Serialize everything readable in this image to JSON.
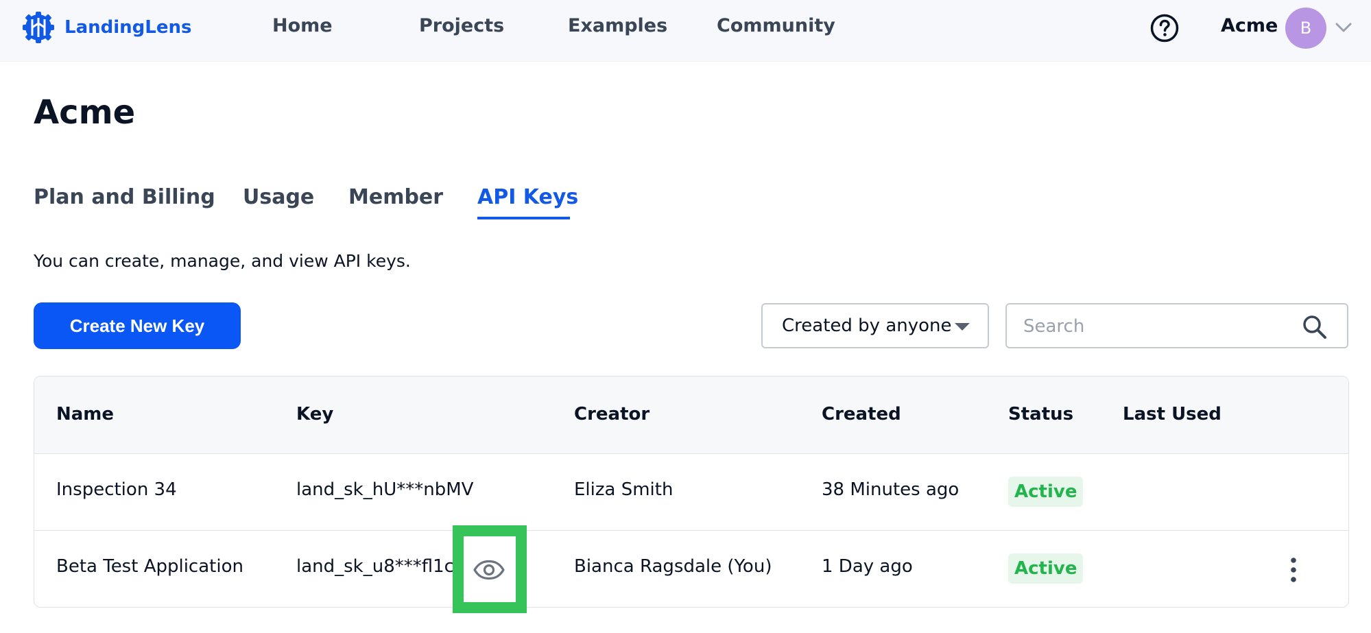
{
  "app": {
    "name": "LandingLens",
    "brand_color": "#1259e6"
  },
  "nav": {
    "items": [
      "Home",
      "Projects",
      "Examples",
      "Community"
    ]
  },
  "account": {
    "name": "Acme",
    "avatar_initial": "B",
    "avatar_color": "#b896e3"
  },
  "page": {
    "title": "Acme",
    "description": "You can create, manage, and view API keys."
  },
  "tabs": [
    {
      "label": "Plan and Billing",
      "active": false
    },
    {
      "label": "Usage",
      "active": false
    },
    {
      "label": "Member",
      "active": false
    },
    {
      "label": "API Keys",
      "active": true
    }
  ],
  "toolbar": {
    "create_label": "Create New Key",
    "filter_value": "Created by anyone",
    "search_placeholder": "Search"
  },
  "table": {
    "columns": [
      "Name",
      "Key",
      "Creator",
      "Created",
      "Status",
      "Last Used"
    ],
    "rows": [
      {
        "name": "Inspection 34",
        "key": "land_sk_hU***nbMV",
        "creator": "Eliza Smith",
        "created": "38 Minutes ago",
        "status": "Active",
        "last_used": ""
      },
      {
        "name": "Beta Test Application",
        "key": "land_sk_u8***fl1c",
        "creator": "Bianca Ragsdale (You)",
        "created": "1 Day ago",
        "status": "Active",
        "last_used": ""
      }
    ]
  },
  "icons": {
    "logo": "landinglens-logo-icon",
    "help": "help-circle-icon",
    "chevron": "chevron-down-icon",
    "search": "search-icon",
    "reveal_key": "eye-icon",
    "row_menu": "kebab-menu-icon"
  },
  "colors": {
    "primary_button": "#0b57f5",
    "active_status": "#21b54b",
    "highlight_box": "#36c35a"
  }
}
